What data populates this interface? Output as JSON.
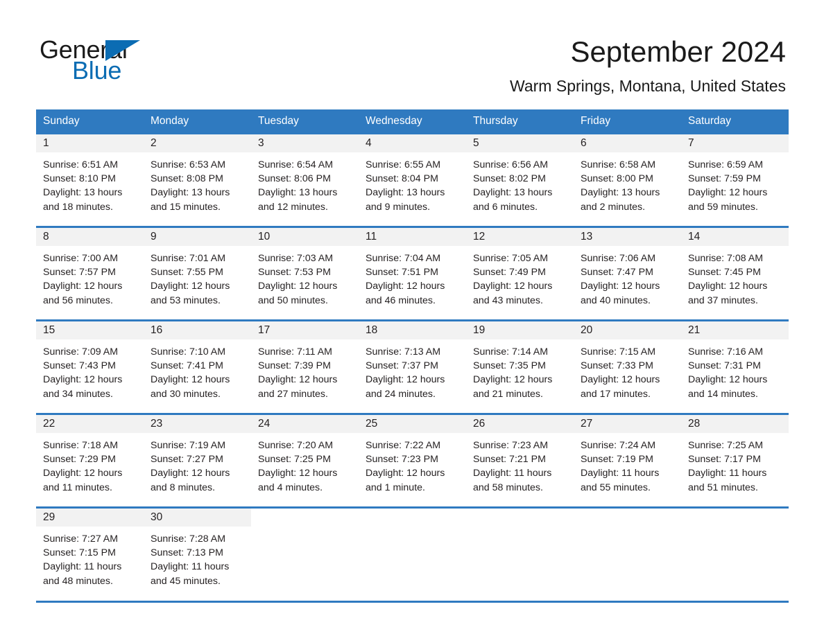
{
  "logo": {
    "word_one": "General",
    "word_two": "Blue",
    "triangle_icon": "triangle-icon",
    "brand_color": "#0b6cb3"
  },
  "header": {
    "month_title": "September 2024",
    "location": "Warm Springs, Montana, United States"
  },
  "theme": {
    "header_blue": "#2f7ac0",
    "day_band_gray": "#f2f2f2",
    "text_color": "#231f20"
  },
  "weekdays": [
    "Sunday",
    "Monday",
    "Tuesday",
    "Wednesday",
    "Thursday",
    "Friday",
    "Saturday"
  ],
  "weeks": [
    [
      {
        "day": "1",
        "sunrise": "Sunrise: 6:51 AM",
        "sunset": "Sunset: 8:10 PM",
        "daylight": "Daylight: 13 hours and 18 minutes."
      },
      {
        "day": "2",
        "sunrise": "Sunrise: 6:53 AM",
        "sunset": "Sunset: 8:08 PM",
        "daylight": "Daylight: 13 hours and 15 minutes."
      },
      {
        "day": "3",
        "sunrise": "Sunrise: 6:54 AM",
        "sunset": "Sunset: 8:06 PM",
        "daylight": "Daylight: 13 hours and 12 minutes."
      },
      {
        "day": "4",
        "sunrise": "Sunrise: 6:55 AM",
        "sunset": "Sunset: 8:04 PM",
        "daylight": "Daylight: 13 hours and 9 minutes."
      },
      {
        "day": "5",
        "sunrise": "Sunrise: 6:56 AM",
        "sunset": "Sunset: 8:02 PM",
        "daylight": "Daylight: 13 hours and 6 minutes."
      },
      {
        "day": "6",
        "sunrise": "Sunrise: 6:58 AM",
        "sunset": "Sunset: 8:00 PM",
        "daylight": "Daylight: 13 hours and 2 minutes."
      },
      {
        "day": "7",
        "sunrise": "Sunrise: 6:59 AM",
        "sunset": "Sunset: 7:59 PM",
        "daylight": "Daylight: 12 hours and 59 minutes."
      }
    ],
    [
      {
        "day": "8",
        "sunrise": "Sunrise: 7:00 AM",
        "sunset": "Sunset: 7:57 PM",
        "daylight": "Daylight: 12 hours and 56 minutes."
      },
      {
        "day": "9",
        "sunrise": "Sunrise: 7:01 AM",
        "sunset": "Sunset: 7:55 PM",
        "daylight": "Daylight: 12 hours and 53 minutes."
      },
      {
        "day": "10",
        "sunrise": "Sunrise: 7:03 AM",
        "sunset": "Sunset: 7:53 PM",
        "daylight": "Daylight: 12 hours and 50 minutes."
      },
      {
        "day": "11",
        "sunrise": "Sunrise: 7:04 AM",
        "sunset": "Sunset: 7:51 PM",
        "daylight": "Daylight: 12 hours and 46 minutes."
      },
      {
        "day": "12",
        "sunrise": "Sunrise: 7:05 AM",
        "sunset": "Sunset: 7:49 PM",
        "daylight": "Daylight: 12 hours and 43 minutes."
      },
      {
        "day": "13",
        "sunrise": "Sunrise: 7:06 AM",
        "sunset": "Sunset: 7:47 PM",
        "daylight": "Daylight: 12 hours and 40 minutes."
      },
      {
        "day": "14",
        "sunrise": "Sunrise: 7:08 AM",
        "sunset": "Sunset: 7:45 PM",
        "daylight": "Daylight: 12 hours and 37 minutes."
      }
    ],
    [
      {
        "day": "15",
        "sunrise": "Sunrise: 7:09 AM",
        "sunset": "Sunset: 7:43 PM",
        "daylight": "Daylight: 12 hours and 34 minutes."
      },
      {
        "day": "16",
        "sunrise": "Sunrise: 7:10 AM",
        "sunset": "Sunset: 7:41 PM",
        "daylight": "Daylight: 12 hours and 30 minutes."
      },
      {
        "day": "17",
        "sunrise": "Sunrise: 7:11 AM",
        "sunset": "Sunset: 7:39 PM",
        "daylight": "Daylight: 12 hours and 27 minutes."
      },
      {
        "day": "18",
        "sunrise": "Sunrise: 7:13 AM",
        "sunset": "Sunset: 7:37 PM",
        "daylight": "Daylight: 12 hours and 24 minutes."
      },
      {
        "day": "19",
        "sunrise": "Sunrise: 7:14 AM",
        "sunset": "Sunset: 7:35 PM",
        "daylight": "Daylight: 12 hours and 21 minutes."
      },
      {
        "day": "20",
        "sunrise": "Sunrise: 7:15 AM",
        "sunset": "Sunset: 7:33 PM",
        "daylight": "Daylight: 12 hours and 17 minutes."
      },
      {
        "day": "21",
        "sunrise": "Sunrise: 7:16 AM",
        "sunset": "Sunset: 7:31 PM",
        "daylight": "Daylight: 12 hours and 14 minutes."
      }
    ],
    [
      {
        "day": "22",
        "sunrise": "Sunrise: 7:18 AM",
        "sunset": "Sunset: 7:29 PM",
        "daylight": "Daylight: 12 hours and 11 minutes."
      },
      {
        "day": "23",
        "sunrise": "Sunrise: 7:19 AM",
        "sunset": "Sunset: 7:27 PM",
        "daylight": "Daylight: 12 hours and 8 minutes."
      },
      {
        "day": "24",
        "sunrise": "Sunrise: 7:20 AM",
        "sunset": "Sunset: 7:25 PM",
        "daylight": "Daylight: 12 hours and 4 minutes."
      },
      {
        "day": "25",
        "sunrise": "Sunrise: 7:22 AM",
        "sunset": "Sunset: 7:23 PM",
        "daylight": "Daylight: 12 hours and 1 minute."
      },
      {
        "day": "26",
        "sunrise": "Sunrise: 7:23 AM",
        "sunset": "Sunset: 7:21 PM",
        "daylight": "Daylight: 11 hours and 58 minutes."
      },
      {
        "day": "27",
        "sunrise": "Sunrise: 7:24 AM",
        "sunset": "Sunset: 7:19 PM",
        "daylight": "Daylight: 11 hours and 55 minutes."
      },
      {
        "day": "28",
        "sunrise": "Sunrise: 7:25 AM",
        "sunset": "Sunset: 7:17 PM",
        "daylight": "Daylight: 11 hours and 51 minutes."
      }
    ],
    [
      {
        "day": "29",
        "sunrise": "Sunrise: 7:27 AM",
        "sunset": "Sunset: 7:15 PM",
        "daylight": "Daylight: 11 hours and 48 minutes."
      },
      {
        "day": "30",
        "sunrise": "Sunrise: 7:28 AM",
        "sunset": "Sunset: 7:13 PM",
        "daylight": "Daylight: 11 hours and 45 minutes."
      },
      {
        "day": "",
        "sunrise": "",
        "sunset": "",
        "daylight": ""
      },
      {
        "day": "",
        "sunrise": "",
        "sunset": "",
        "daylight": ""
      },
      {
        "day": "",
        "sunrise": "",
        "sunset": "",
        "daylight": ""
      },
      {
        "day": "",
        "sunrise": "",
        "sunset": "",
        "daylight": ""
      },
      {
        "day": "",
        "sunrise": "",
        "sunset": "",
        "daylight": ""
      }
    ]
  ]
}
